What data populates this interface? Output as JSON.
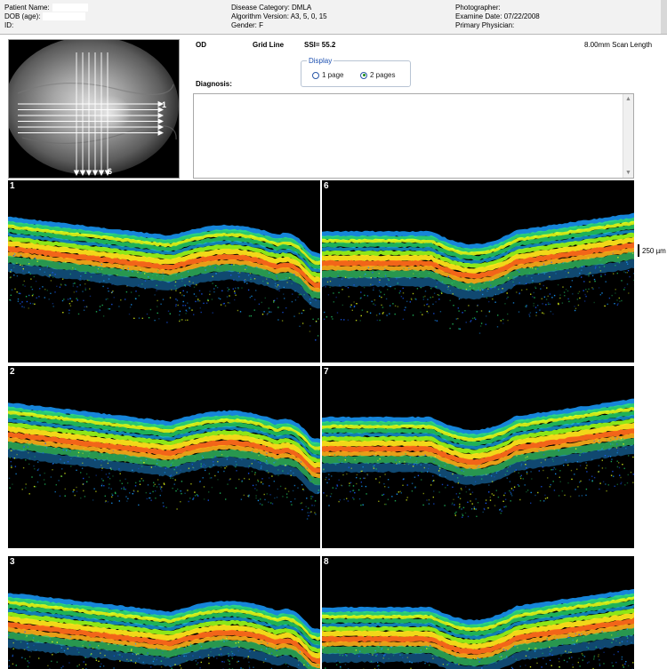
{
  "header": {
    "patient_name_label": "Patient Name:",
    "dob_label": "DOB (age):",
    "id_label": "ID:",
    "disease_category": "Disease Category: DMLA",
    "algorithm_version": "Algorithm Version: A3, 5, 0, 15",
    "gender": "Gender: F",
    "photographer_label": "Photographer:",
    "exam_date": "Examine Date: 07/22/2008",
    "primary_physician_label": "Primary Physician:"
  },
  "fundus": {
    "first_line_label": "1",
    "last_line_label": "6"
  },
  "info": {
    "eye": "OD",
    "scan_pattern": "Grid Line",
    "ssi": "SSI= 55.2",
    "scan_length": "8.00mm Scan Length",
    "diagnosis_label": "Diagnosis:"
  },
  "display": {
    "legend": "Display",
    "options": [
      "1 page",
      "2 pages"
    ],
    "selected": "2 pages"
  },
  "scans": [
    {
      "number": "1"
    },
    {
      "number": "6"
    },
    {
      "number": "2"
    },
    {
      "number": "7"
    },
    {
      "number": "3"
    },
    {
      "number": "8"
    }
  ],
  "scale": {
    "label": "250 µm"
  },
  "colors": {
    "background": "#000000",
    "retina_warm": "#ff6a1a",
    "retina_mid": "#e6ff1a",
    "retina_cool": "#1ab4ff"
  }
}
